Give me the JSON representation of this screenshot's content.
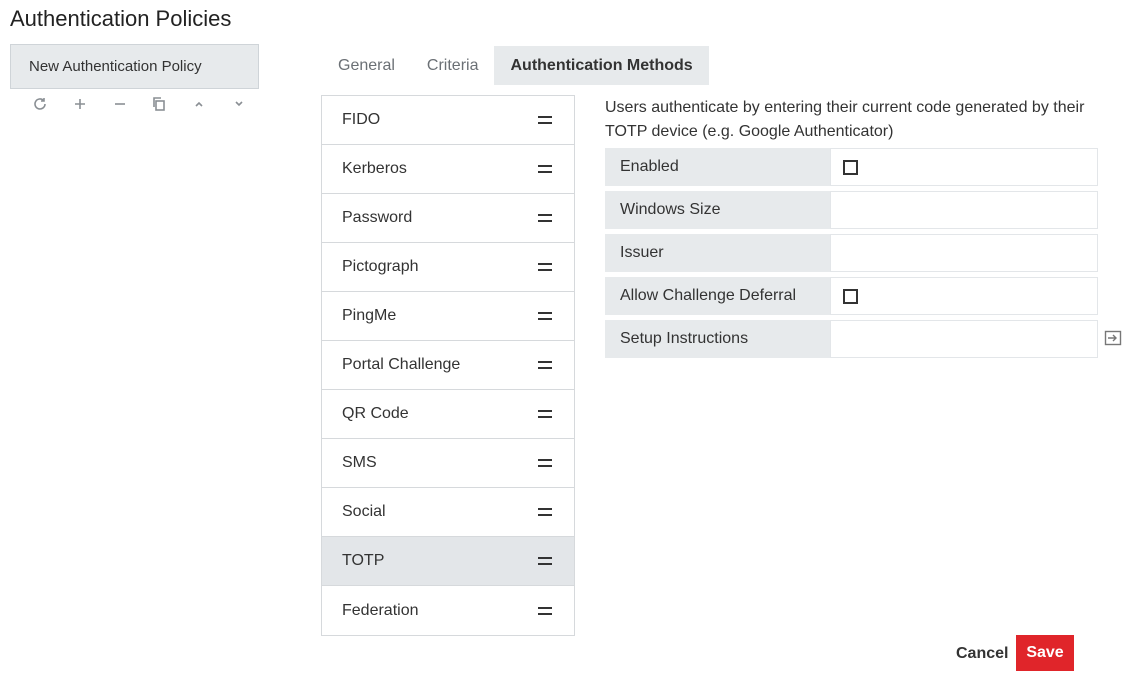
{
  "page": {
    "title": "Authentication Policies"
  },
  "policies": {
    "items": [
      {
        "label": "New Authentication Policy"
      }
    ]
  },
  "toolbar": {
    "icons": [
      "refresh-icon",
      "plus-icon",
      "minus-icon",
      "copy-icon",
      "chevron-up-icon",
      "chevron-down-icon"
    ]
  },
  "tabs": [
    {
      "label": "General",
      "active": false
    },
    {
      "label": "Criteria",
      "active": false
    },
    {
      "label": "Authentication Methods",
      "active": true
    }
  ],
  "methods": [
    {
      "label": "FIDO",
      "selected": false
    },
    {
      "label": "Kerberos",
      "selected": false
    },
    {
      "label": "Password",
      "selected": false
    },
    {
      "label": "Pictograph",
      "selected": false
    },
    {
      "label": "PingMe",
      "selected": false
    },
    {
      "label": "Portal Challenge",
      "selected": false
    },
    {
      "label": "QR Code",
      "selected": false
    },
    {
      "label": "SMS",
      "selected": false
    },
    {
      "label": "Social",
      "selected": false
    },
    {
      "label": "TOTP",
      "selected": true
    },
    {
      "label": "Federation",
      "selected": false
    }
  ],
  "detail": {
    "description": "Users authenticate by entering their current code generated by their TOTP device (e.g. Google Authenticator)",
    "fields": {
      "enabled": {
        "label": "Enabled",
        "checked": false
      },
      "window_size": {
        "label": "Windows Size",
        "value": ""
      },
      "issuer": {
        "label": "Issuer",
        "value": ""
      },
      "allow_challenge_deferral": {
        "label": "Allow Challenge Deferral",
        "checked": false
      },
      "setup_instructions": {
        "label": "Setup Instructions",
        "value": ""
      }
    }
  },
  "footer": {
    "cancel_label": "Cancel",
    "save_label": "Save"
  },
  "colors": {
    "accent": "#e0252a",
    "panel": "#e7eaec",
    "border": "#d6d9dc"
  }
}
